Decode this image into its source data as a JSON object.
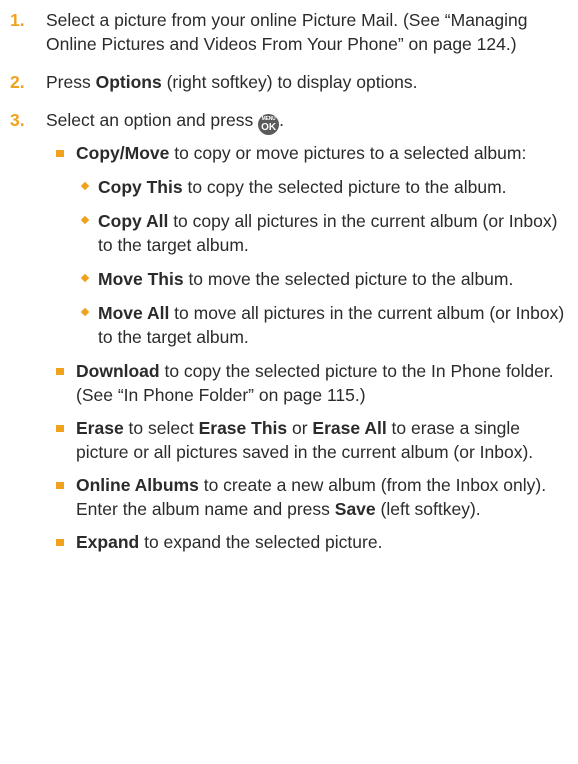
{
  "steps": [
    {
      "number": "1.",
      "text": "Select a picture from your online Picture Mail. (See “Managing Online Pictures and Videos From Your Phone” on page 124.)"
    },
    {
      "number": "2.",
      "prefix": "Press ",
      "bold": "Options",
      "suffix": " (right softkey) to display options."
    },
    {
      "number": "3.",
      "prefix": "Select an option and press ",
      "icon_top": "MENU",
      "icon_bottom": "OK",
      "suffix": "."
    }
  ],
  "options": {
    "copy_move": {
      "label": "Copy/Move",
      "text": " to copy or move pictures to a selected album:",
      "sub": [
        {
          "label": "Copy This",
          "text": " to copy the selected picture to the album."
        },
        {
          "label": "Copy All",
          "text": " to copy all pictures in the current album (or Inbox) to the target album."
        },
        {
          "label": "Move This",
          "text": " to move the selected picture to the album."
        },
        {
          "label": "Move All",
          "text": " to move all pictures in the current album (or Inbox) to the target album."
        }
      ]
    },
    "download": {
      "label": "Download",
      "text": " to copy the selected picture to the In Phone folder. (See “In Phone Folder” on page 115.)"
    },
    "erase": {
      "label": "Erase",
      "t1": " to select ",
      "b1": "Erase This",
      "t2": " or ",
      "b2": "Erase All",
      "t3": " to erase a single picture or all pictures saved in the current album (or Inbox)."
    },
    "online_albums": {
      "label": "Online Albums",
      "t1": " to create a new album (from the Inbox only). Enter the album name and press ",
      "b1": "Save",
      "t2": " (left softkey)."
    },
    "expand": {
      "label": "Expand",
      "text": " to expand the selected picture."
    }
  },
  "colors": {
    "accent": "#f0a21e",
    "text": "#2b2b2b",
    "icon_bg": "#5a5a5a"
  }
}
